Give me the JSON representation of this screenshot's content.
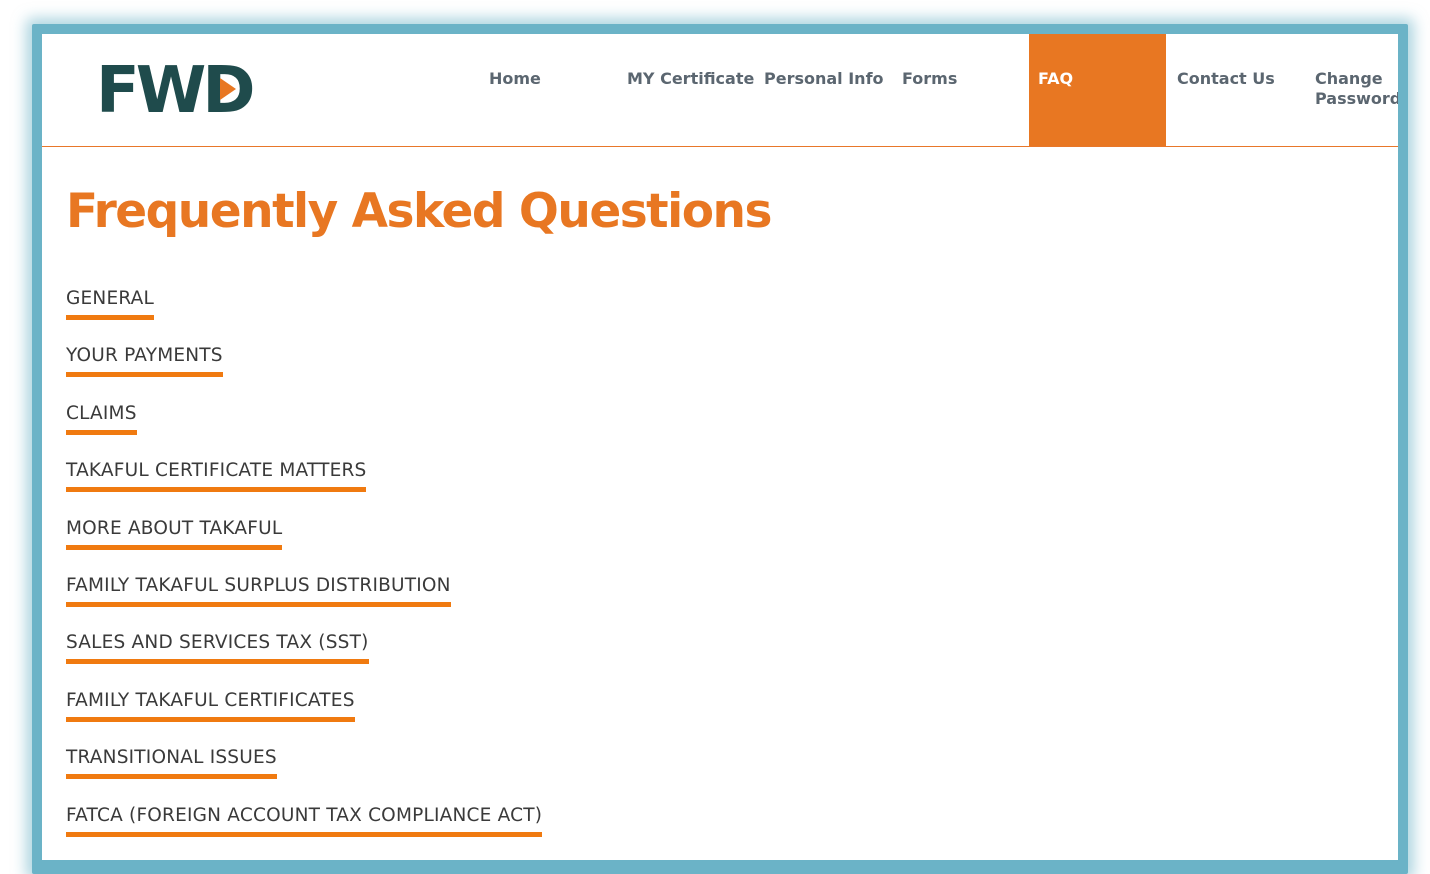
{
  "brand": {
    "logo_text": "FWD",
    "accent_color": "#e87722",
    "logo_color": "#1f4b4c",
    "frame_color": "#6bb3c7"
  },
  "nav": {
    "items": [
      {
        "label": "Home"
      },
      {
        "label": "MY Certificate"
      },
      {
        "label": "Personal Info"
      },
      {
        "label": "Forms"
      },
      {
        "label": "FAQ",
        "active": true
      },
      {
        "label": "Contact Us"
      },
      {
        "label_line1": "Change",
        "label_line2": "Password"
      }
    ]
  },
  "page": {
    "title": "Frequently Asked Questions"
  },
  "faq": {
    "categories": [
      "GENERAL",
      "YOUR PAYMENTS",
      "CLAIMS",
      "TAKAFUL CERTIFICATE MATTERS",
      "MORE ABOUT TAKAFUL",
      "FAMILY TAKAFUL SURPLUS DISTRIBUTION",
      "SALES AND SERVICES TAX (SST)",
      "FAMILY TAKAFUL CERTIFICATES",
      "TRANSITIONAL ISSUES",
      "FATCA (FOREIGN ACCOUNT TAX COMPLIANCE ACT)"
    ]
  }
}
